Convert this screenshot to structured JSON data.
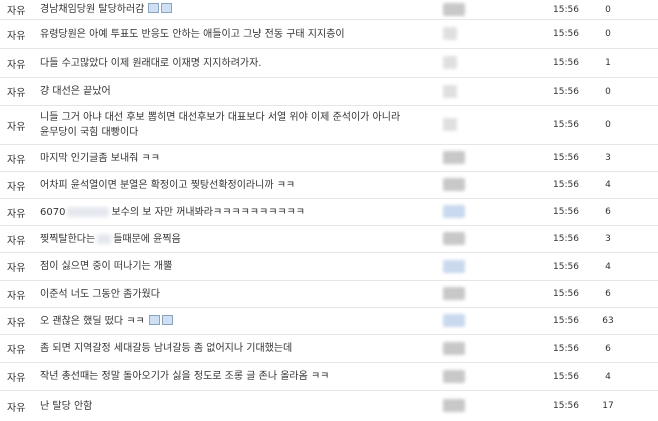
{
  "rows": [
    {
      "category": "자유",
      "title": "경남채임당원 탈당하러감",
      "has_image": true,
      "time": "15:56",
      "views": "0"
    },
    {
      "category": "자유",
      "title": "유령당원은 아예 투표도 반응도 안하는 애들이고 그냥 전동 구태 지지층이",
      "has_image": false,
      "time": "15:56",
      "views": "0"
    },
    {
      "category": "자유",
      "title": "다들 수고많았다 이제 원래대로 이재명 지지하려가자.",
      "has_image": false,
      "time": "15:56",
      "views": "1"
    },
    {
      "category": "자유",
      "title": "걍 대선은 끝났어",
      "has_image": false,
      "time": "15:56",
      "views": "0"
    },
    {
      "category": "자유",
      "title": "니들 그거 아냐 대선 후보 뽑히면 대선후보가 대표보다 서열 위야 이제 준석이가 아니라 윤무당이 국힘 대빵이다",
      "has_image": false,
      "time": "15:56",
      "views": "0"
    },
    {
      "category": "자유",
      "title": "마지막 인기글좀 보내줘 ㅋㅋ",
      "has_image": false,
      "time": "15:56",
      "views": "3"
    },
    {
      "category": "자유",
      "title": "어차피 윤석열이면 분열은 확정이고 찢탕선확정이라니까 ㅋㅋ",
      "has_image": false,
      "time": "15:56",
      "views": "4"
    },
    {
      "category": "자유",
      "title_pre": "6070",
      "title_post": "보수의 보 자만 꺼내봐라ㅋㅋㅋㅋㅋㅋㅋㅋㅋㅋ",
      "has_image": false,
      "time": "15:56",
      "views": "6"
    },
    {
      "category": "자유",
      "title_pre": "찢찍탈한다는",
      "title_post": "들때문에 윤찍음",
      "has_image": false,
      "time": "15:56",
      "views": "3"
    },
    {
      "category": "자유",
      "title": "점이 싫으면 중이 떠나기는 개뿔",
      "has_image": false,
      "time": "15:56",
      "views": "4"
    },
    {
      "category": "자유",
      "title": "이준석 너도 그동안 좀가웠다",
      "has_image": false,
      "time": "15:56",
      "views": "6"
    },
    {
      "category": "자유",
      "title": "오 괜찮은 했딜 떴다 ㅋㅋ",
      "has_image": true,
      "time": "15:56",
      "views": "63"
    },
    {
      "category": "자유",
      "title": "좀 되면 지역갈정 세대갈등 남녀갈등 좀 없어지나 기대했는데",
      "has_image": false,
      "time": "15:56",
      "views": "6"
    },
    {
      "category": "자유",
      "title": "작년 총선때는 정말 돌아오기가 싫을 정도로 조롱 글 존나 올라옴 ㅋㅋ",
      "has_image": false,
      "time": "15:56",
      "views": "4"
    },
    {
      "category": "자유",
      "title": "난 탈당 안함",
      "has_image": false,
      "time": "15:56",
      "views": "17"
    }
  ]
}
